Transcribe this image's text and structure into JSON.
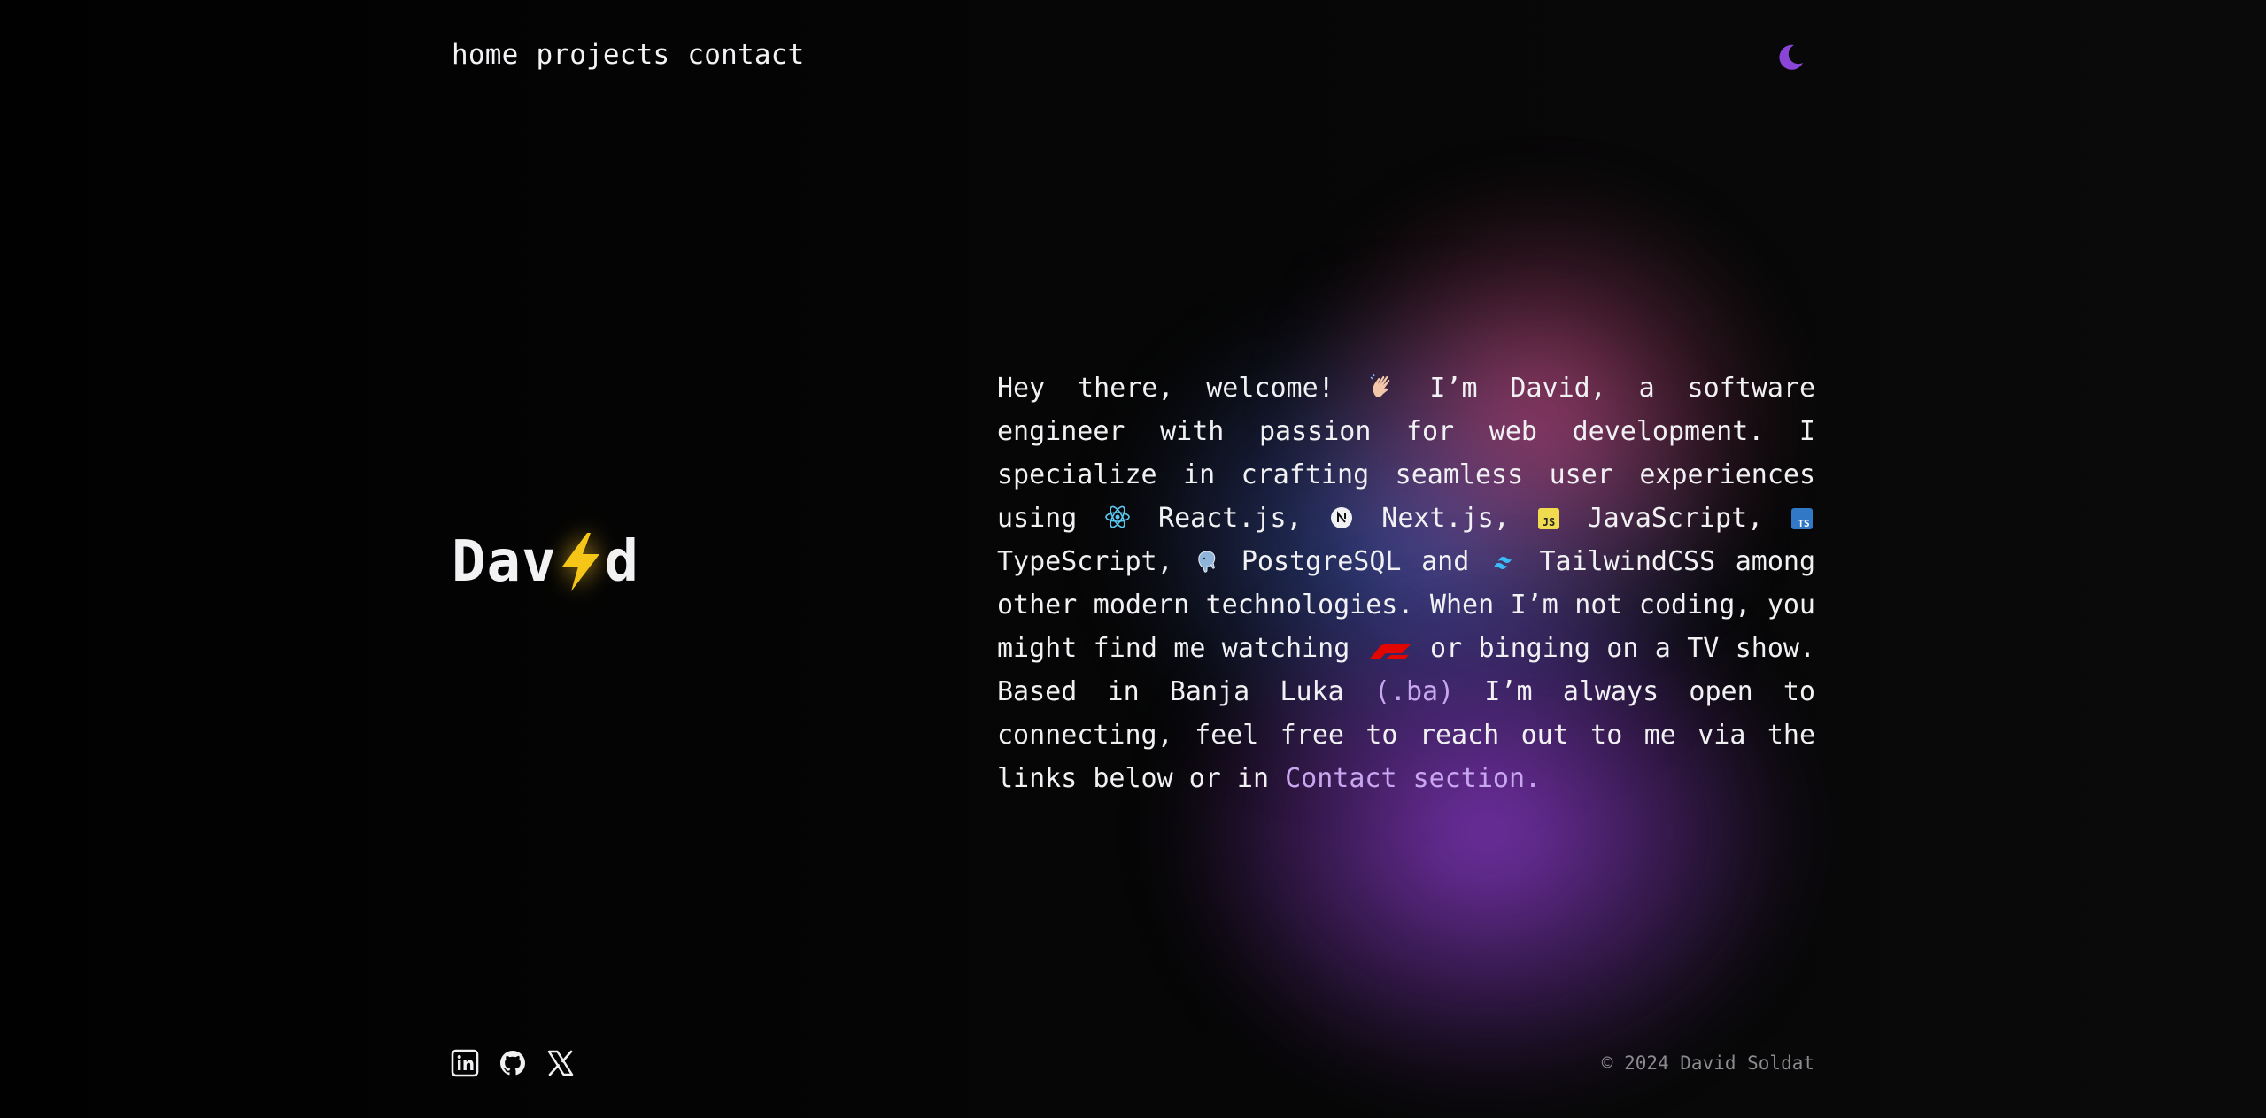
{
  "nav": {
    "items": [
      {
        "label": "home"
      },
      {
        "label": "projects"
      },
      {
        "label": "contact"
      }
    ]
  },
  "theme_toggle": {
    "icon": "moon-icon",
    "color": "#8b45d6"
  },
  "logo": {
    "before": "Dav",
    "after": "d",
    "icon": "lightning-bolt-icon",
    "icon_color": "#f5c518"
  },
  "bio": {
    "t1": "Hey there, welcome! ",
    "t2": " I’m David, a software engineer with passion for web development. I specialize in crafting seamless user experiences using ",
    "react": "React.js",
    "next": "Next.js",
    "js": "JavaScript",
    "ts": "TypeScript",
    "pg": "PostgreSQL",
    "and": " and ",
    "tw": "TailwindCSS",
    "t3": " among other modern technologies. When I’m not coding, you might find me watching ",
    "t4": " or binging on a TV show. Based in Banja Luka ",
    "ba": "(.ba)",
    "t5": " I’m always open to connecting, feel free to reach out to me via the links below or in ",
    "contact_link": "Contact section."
  },
  "footer": {
    "socials": [
      {
        "icon": "linkedin-icon"
      },
      {
        "icon": "github-icon"
      },
      {
        "icon": "x-icon"
      }
    ],
    "copyright": "© 2024 David Soldat"
  },
  "colors": {
    "background": "#050505",
    "accent": "#c9a6f0",
    "text": "#f1f1f4"
  }
}
